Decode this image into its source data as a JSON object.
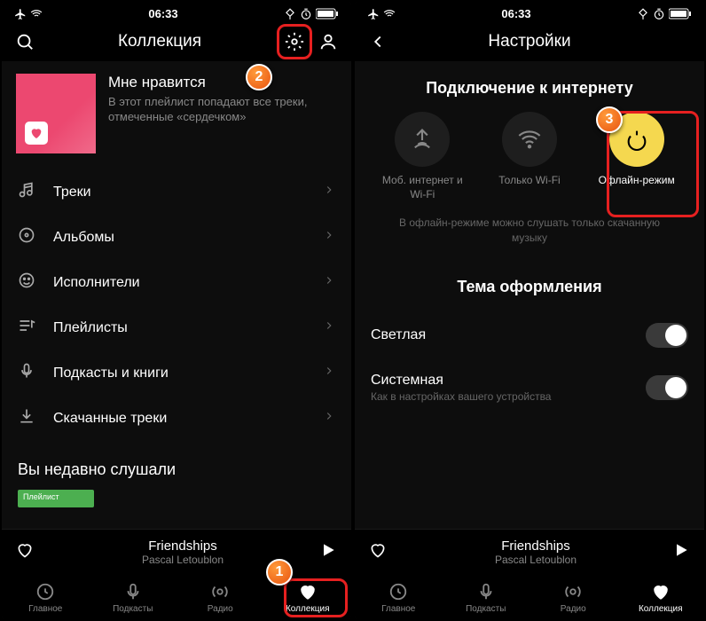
{
  "status": {
    "time": "06:33"
  },
  "screens": {
    "collection": {
      "title": "Коллекция",
      "liked": {
        "title": "Мне нравится",
        "subtitle": "В этот плейлист попадают все треки, отмеченные «сердечком»"
      },
      "menu": [
        "Треки",
        "Альбомы",
        "Исполнители",
        "Плейлисты",
        "Подкасты и книги",
        "Скачанные треки"
      ],
      "recent": "Вы недавно слушали",
      "chip": "Плейлист"
    },
    "settings": {
      "title": "Настройки",
      "conn": {
        "heading": "Подключение к интернету",
        "opts": [
          "Моб. интернет и Wi-Fi",
          "Только Wi-Fi",
          "Офлайн-режим"
        ],
        "hint": "В офлайн-режиме можно слушать только скачанную музыку"
      },
      "theme": {
        "heading": "Тема оформления",
        "light": "Светлая",
        "system": "Системная",
        "systemHint": "Как в настройках вашего устройства"
      }
    }
  },
  "player": {
    "track": "Friendships",
    "artist": "Pascal Letoublon"
  },
  "tabs": [
    "Главное",
    "Подкасты",
    "Радио",
    "Коллекция"
  ],
  "markers": {
    "1": "1",
    "2": "2",
    "3": "3"
  }
}
